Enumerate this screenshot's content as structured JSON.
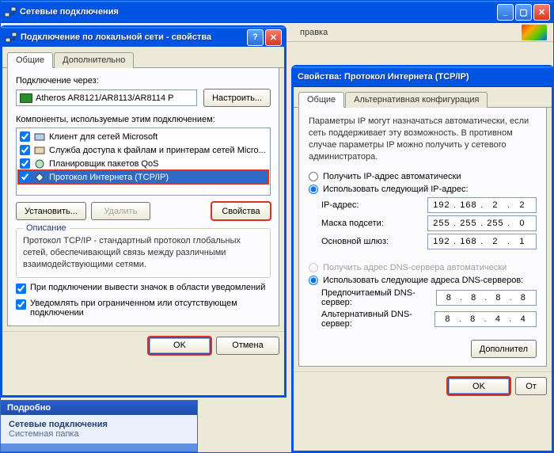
{
  "parent": {
    "title": "Сетевые подключения",
    "menu_help": "правка"
  },
  "props": {
    "title": "Подключение по локальной сети - свойства",
    "tab_general": "Общие",
    "tab_advanced": "Дополнительно",
    "connect_via_label": "Подключение через:",
    "adapter": "Atheros AR8121/AR8113/AR8114 P",
    "configure_btn": "Настроить...",
    "components_label": "Компоненты, используемые этим подключением:",
    "items": [
      {
        "label": "Клиент для сетей Microsoft",
        "checked": true
      },
      {
        "label": "Служба доступа к файлам и принтерам сетей Micro...",
        "checked": true
      },
      {
        "label": "Планировщик пакетов QoS",
        "checked": true
      },
      {
        "label": "Протокол Интернета (TCP/IP)",
        "checked": true
      }
    ],
    "install_btn": "Установить...",
    "remove_btn": "Удалить",
    "props_btn": "Свойства",
    "desc_title": "Описание",
    "desc_text": "Протокол TCP/IP - стандартный протокол глобальных сетей, обеспечивающий связь между различными взаимодействующими сетями.",
    "chk_tray": "При подключении вывести значок в области уведомлений",
    "chk_notify": "Уведомлять при ограниченном или отсутствующем подключении",
    "ok_btn": "OK",
    "cancel_btn": "Отмена"
  },
  "tcpip": {
    "title": "Свойства: Протокол Интернета (TCP/IP)",
    "tab_general": "Общие",
    "tab_alt": "Альтернативная конфигурация",
    "help_text": "Параметры IP могут назначаться автоматически, если сеть поддерживает эту возможность. В противном случае параметры IP можно получить у сетевого администратора.",
    "radio_ip_auto": "Получить IP-адрес автоматически",
    "radio_ip_manual": "Использовать следующий IP-адрес:",
    "lbl_ip": "IP-адрес:",
    "lbl_mask": "Маска подсети:",
    "lbl_gw": "Основной шлюз:",
    "ip": [
      "192",
      "168",
      "2",
      "2"
    ],
    "mask": [
      "255",
      "255",
      "255",
      "0"
    ],
    "gw": [
      "192",
      "168",
      "2",
      "1"
    ],
    "radio_dns_auto": "Получить адрес DNS-сервера автоматически",
    "radio_dns_manual": "Использовать следующие адреса DNS-серверов:",
    "lbl_dns1": "Предпочитаемый DNS-сервер:",
    "lbl_dns2": "Альтернативный DNS-сервер:",
    "dns1": [
      "8",
      "8",
      "8",
      "8"
    ],
    "dns2": [
      "8",
      "8",
      "4",
      "4"
    ],
    "advanced_btn": "Дополнител",
    "ok_btn": "OK",
    "cancel_btn": "От"
  },
  "bluepanel": {
    "header": "Подробно",
    "line1": "Сетевые подключения",
    "line2": "Системная папка"
  }
}
